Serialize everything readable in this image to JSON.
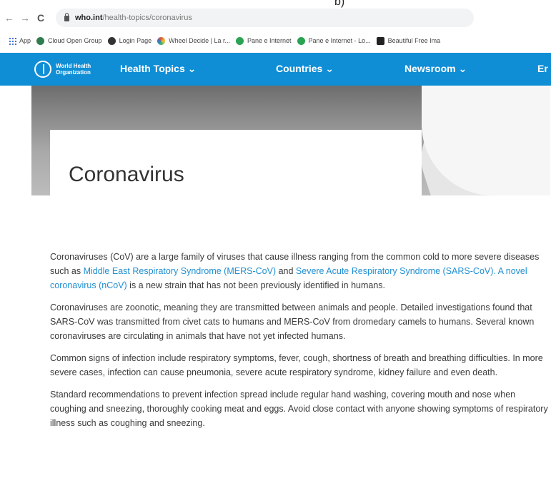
{
  "top_label": "b)",
  "browser": {
    "nav": {
      "back": "←",
      "forward": "→",
      "reload": "C"
    },
    "url": {
      "domain": "who.int",
      "path": "/health-topics/coronavirus"
    },
    "bookmarks": [
      {
        "label": "App",
        "icon": "apps-grid-icon",
        "color": "#3b6fd4"
      },
      {
        "label": "Cloud Open Group",
        "icon": "cloud-group-icon",
        "color": "#2f7d4f"
      },
      {
        "label": "Login Page",
        "icon": "login-swirl-icon",
        "color": "#333333"
      },
      {
        "label": "Wheel Decide | La r...",
        "icon": "color-wheel-icon",
        "color": "#e85a2a"
      },
      {
        "label": "Pane e Internet",
        "icon": "globe-icon",
        "color": "#2aa352"
      },
      {
        "label": "Pane e Internet - Lo...",
        "icon": "globe-icon",
        "color": "#2aa352"
      },
      {
        "label": "Beautiful Free Ima",
        "icon": "camera-icon",
        "color": "#222222"
      }
    ]
  },
  "who_nav": {
    "logo_line1": "World Health",
    "logo_line2": "Organization",
    "items": [
      "Health Topics ⌄",
      "Countries ⌄",
      "Newsroom ⌄",
      "Er"
    ]
  },
  "hero": {
    "title": "Coronavirus"
  },
  "article": {
    "p1": {
      "t1": "Coronaviruses (CoV) are a large family of viruses that cause illness ranging from the common cold to more severe diseases such as ",
      "l1": "Middle East Respiratory Syndrome (MERS-CoV)",
      "t2": " and ",
      "l2": "Severe Acute Respiratory Syndrome (SARS-CoV). A novel coronavirus (nCoV)",
      "t3": " is a new strain that has not been previously identified in humans."
    },
    "p2": "Coronaviruses are zoonotic, meaning they are transmitted between animals and people.  Detailed investigations found that SARS-CoV was transmitted from civet cats to humans and MERS-CoV from dromedary camels to humans. Several known coronaviruses are circulating in animals that have not yet infected humans.",
    "p3": "Common signs of infection include respiratory symptoms, fever, cough, shortness of breath and breathing difficulties. In more severe cases, infection can cause pneumonia, severe acute respiratory syndrome, kidney failure and even death.",
    "p4": "Standard recommendations to prevent infection spread include regular hand washing, covering mouth and nose when coughing and sneezing, thoroughly cooking meat and eggs. Avoid close contact with anyone showing symptoms of respiratory illness such as coughing and sneezing."
  }
}
